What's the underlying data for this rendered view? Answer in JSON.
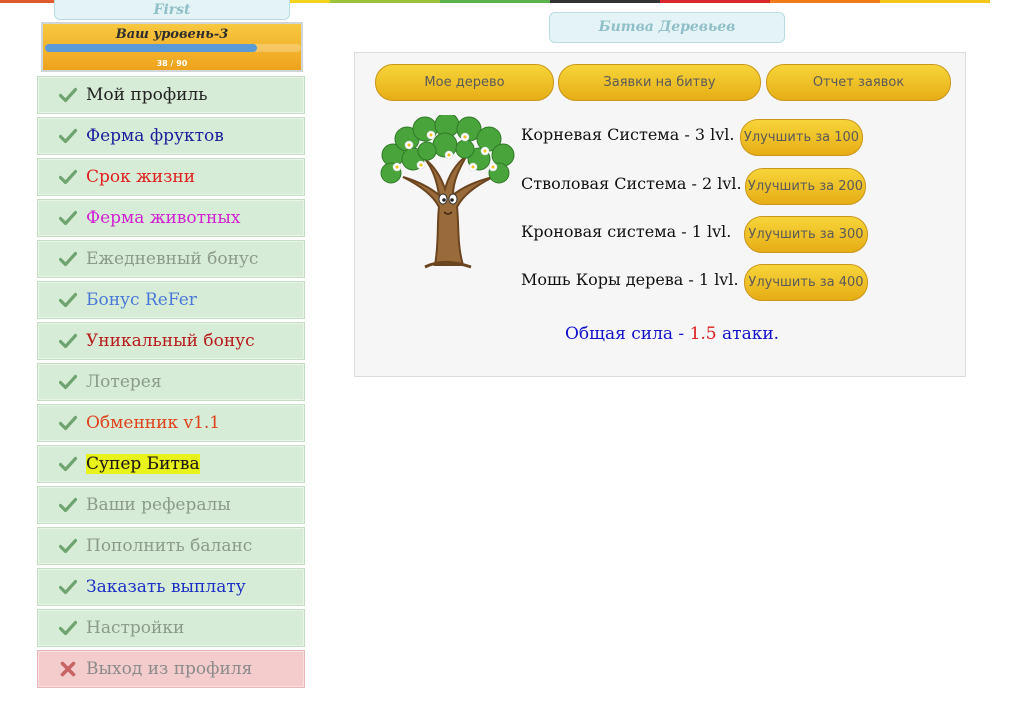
{
  "colors": {
    "stripe": [
      "#e05a2e",
      "#f3a51b",
      "#f4d21c",
      "#9bc43b",
      "#5cb24a",
      "#333333",
      "#d8262b",
      "#f07d1a",
      "#f5c518"
    ],
    "accent_gold": "#f0b820",
    "menu_green": "#d6ecd6",
    "menu_red": "#f4cccc",
    "check_green": "#6fa36f",
    "cross_red": "#c86464"
  },
  "header": {
    "username": "First",
    "level_label": "Ваш уровень-3",
    "level_progress": "38 / 90",
    "level_fraction": 0.83
  },
  "sidebar": {
    "items": [
      {
        "label": "Мой профиль",
        "color": "#222222",
        "icon": "check-icon"
      },
      {
        "label": "Ферма фруктов",
        "color": "#1b1f9c",
        "icon": "check-icon"
      },
      {
        "label": "Срок жизни",
        "color": "#e01f1f",
        "icon": "check-icon"
      },
      {
        "label": "Ферма животных",
        "color": "#d21fd2",
        "icon": "check-icon"
      },
      {
        "label": "Ежедневный бонус",
        "color": "#8b9a8b",
        "icon": "check-icon"
      },
      {
        "label": "Бонус ReFer",
        "color": "#4a78d8",
        "icon": "check-icon"
      },
      {
        "label": "Уникальный бонус",
        "color": "#b71a1a",
        "icon": "check-icon"
      },
      {
        "label": "Лотерея",
        "color": "#8b9a8b",
        "icon": "check-icon"
      },
      {
        "label": "Обменник v1.1",
        "color": "#e0401a",
        "icon": "check-icon"
      },
      {
        "label": "Супер Битва",
        "color": "#1a1a1a",
        "icon": "check-icon",
        "highlight": "#e8f31a"
      },
      {
        "label": "Ваши рефералы",
        "color": "#8b9a8b",
        "icon": "check-icon"
      },
      {
        "label": "Пополнить баланс",
        "color": "#8b9a8b",
        "icon": "check-icon"
      },
      {
        "label": "Заказать выплату",
        "color": "#1b2fc4",
        "icon": "check-icon"
      },
      {
        "label": "Настройки",
        "color": "#8b9a8b",
        "icon": "check-icon"
      },
      {
        "label": "Выход из профиля",
        "color": "#8b8b8b",
        "icon": "cross-icon"
      }
    ]
  },
  "main": {
    "title": "Битва Деревьев",
    "tabs": [
      {
        "label": "Мое дерево"
      },
      {
        "label": "Заявки на битву"
      },
      {
        "label": "Отчет заявок"
      }
    ],
    "tree_icon": "tree-icon",
    "upgrades": [
      {
        "text": "Корневая Система - 3 lvl.",
        "button": "Улучшить за 100"
      },
      {
        "text": "Стволовая Система - 2 lvl.",
        "button": "Улучшить за 200"
      },
      {
        "text": "Кроновая система - 1 lvl.",
        "button": "Улучшить за 300"
      },
      {
        "text": "Мошь Коры дерева - 1 lvl.",
        "button": "Улучшить за 400"
      }
    ],
    "total": {
      "prefix": "Общая сила - ",
      "value": "1.5",
      "suffix": " атаки."
    }
  }
}
